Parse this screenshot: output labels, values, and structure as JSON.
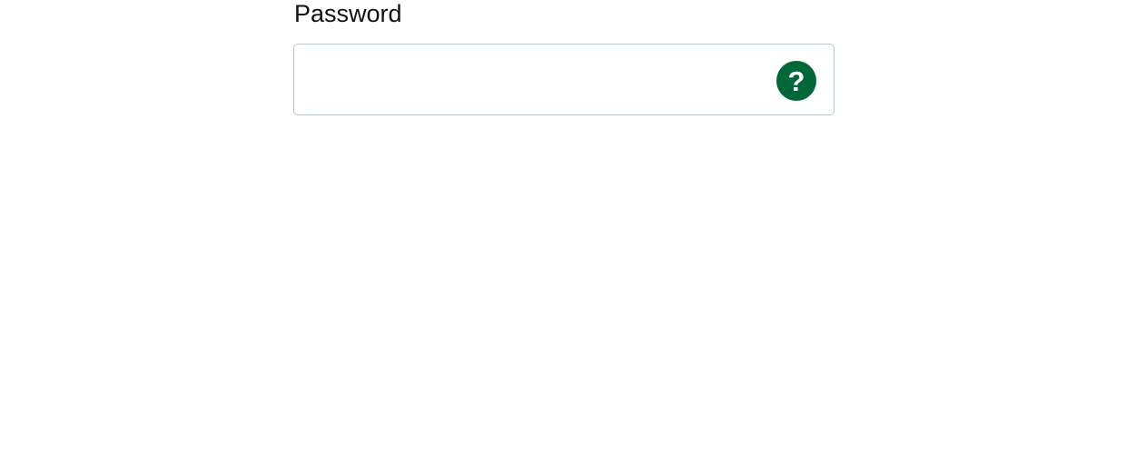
{
  "password_field": {
    "label": "Password",
    "value": "",
    "placeholder": "",
    "help_icon": "question-mark-circle-icon",
    "help_glyph": "?",
    "help_color": "#006838",
    "border_color": "#b9c6cb"
  }
}
